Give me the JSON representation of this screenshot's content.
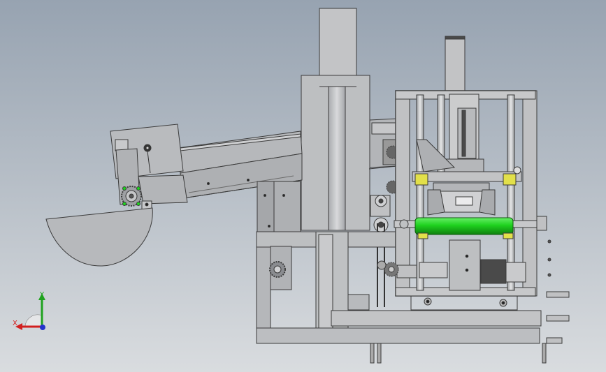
{
  "viewport": {
    "background_top": "#97a3b1",
    "background_bottom": "#d9dcdf"
  },
  "triad": {
    "x_label": "X",
    "y_label": "Y",
    "x_color": "#d21f1f",
    "y_color": "#1fa21f",
    "z_color": "#2233cc"
  },
  "colors": {
    "metal": "#b9bbbe",
    "metal_dark": "#8f9296",
    "edge": "#3a3a3a",
    "roller_green": "#1ed11e",
    "yellow_bushing": "#e2e04a",
    "dark_block": "#4a4a4a"
  }
}
